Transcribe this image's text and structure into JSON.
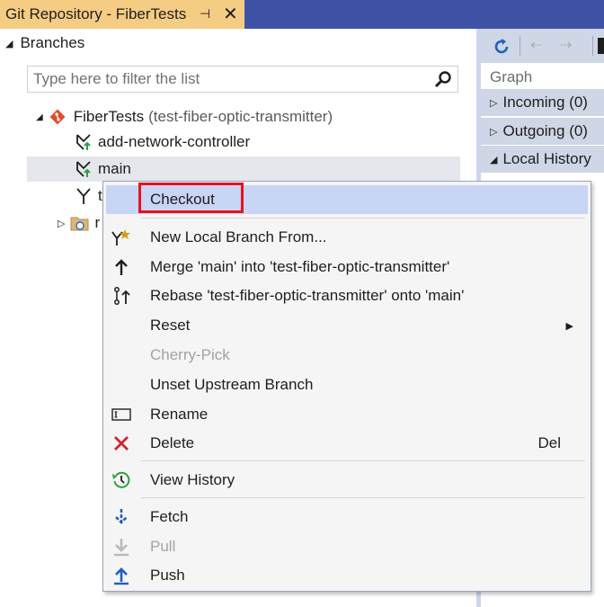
{
  "window": {
    "tab_title": "Git Repository - FiberTests",
    "pin_glyph": "⊣",
    "close_glyph": "✕"
  },
  "branches": {
    "header": "Branches",
    "filter_placeholder": "Type here to filter the list",
    "repo_name": "FiberTests",
    "repo_branch": "(test-fiber-optic-transmitter)",
    "items": [
      {
        "label": "add-network-controller"
      },
      {
        "label": "main"
      },
      {
        "label": "t"
      },
      {
        "label": "r"
      }
    ]
  },
  "right_pane": {
    "graph_label": "Graph",
    "incoming": "Incoming (0)",
    "outgoing": "Outgoing (0)",
    "local_history": "Local History"
  },
  "context_menu": {
    "items": [
      {
        "label": "Checkout",
        "icon": "none"
      },
      {
        "label": "New Local Branch From...",
        "icon": "new-branch-icon"
      },
      {
        "label": "Merge 'main' into 'test-fiber-optic-transmitter'",
        "icon": "merge-icon"
      },
      {
        "label": "Rebase 'test-fiber-optic-transmitter' onto 'main'",
        "icon": "rebase-icon"
      },
      {
        "label": "Reset",
        "icon": "none",
        "submenu": true
      },
      {
        "label": "Cherry-Pick",
        "icon": "none",
        "disabled": true
      },
      {
        "label": "Unset Upstream Branch",
        "icon": "none"
      },
      {
        "label": "Rename",
        "icon": "rename-icon"
      },
      {
        "label": "Delete",
        "icon": "delete-icon",
        "shortcut": "Del"
      },
      {
        "label": "View History",
        "icon": "history-icon"
      },
      {
        "label": "Fetch",
        "icon": "fetch-icon"
      },
      {
        "label": "Pull",
        "icon": "pull-icon",
        "disabled": true
      },
      {
        "label": "Push",
        "icon": "push-icon"
      }
    ],
    "submenu_arrow": "▶"
  },
  "colors": {
    "title_bar": "#3f52a6",
    "active_tab": "#f5cc84",
    "menu_highlight": "#c9d5f5",
    "highlight_box": "#e8111d",
    "git_orange": "#e24d2d",
    "branch_green": "#2ea043"
  }
}
